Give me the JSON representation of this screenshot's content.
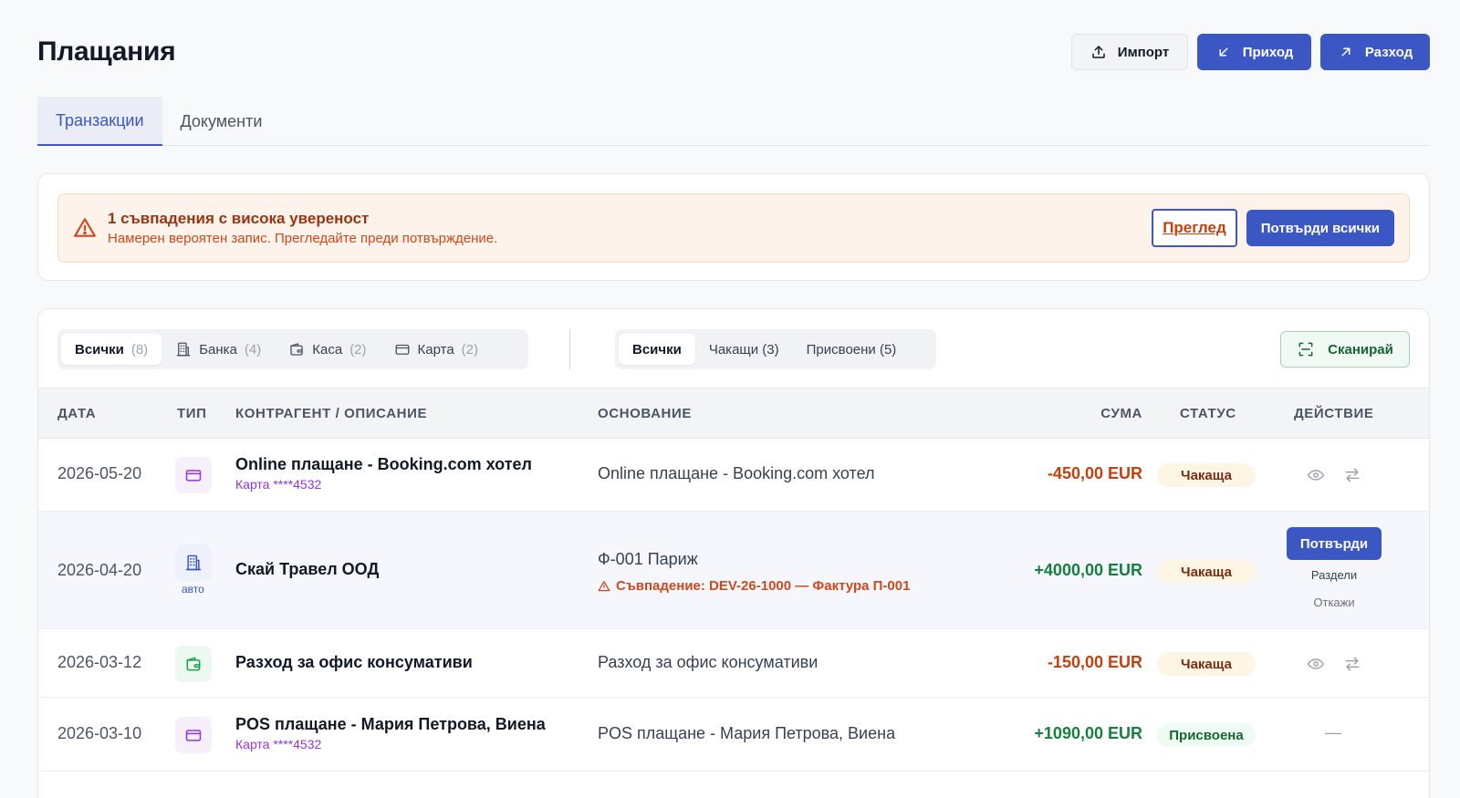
{
  "page": {
    "title": "Плащания"
  },
  "header": {
    "import_label": "Импорт",
    "income_label": "Приход",
    "expense_label": "Разход"
  },
  "tabs": [
    {
      "label": "Транзакции",
      "active": true
    },
    {
      "label": "Документи",
      "active": false
    }
  ],
  "alert": {
    "title": "1 съвпадения с висока увереност",
    "subtitle": "Намерен вероятен запис. Прегледайте преди потвърждение.",
    "review_label": "Преглед",
    "confirm_all_label": "Потвърди всички"
  },
  "filters": {
    "source": [
      {
        "label": "Всички",
        "count": "(8)",
        "active": true
      },
      {
        "label": "Банка",
        "count": "(4)",
        "icon": "bank-icon"
      },
      {
        "label": "Каса",
        "count": "(2)",
        "icon": "wallet-icon"
      },
      {
        "label": "Карта",
        "count": "(2)",
        "icon": "card-icon"
      }
    ],
    "status": [
      {
        "label": "Всички",
        "active": true
      },
      {
        "label": "Чакащи (3)"
      },
      {
        "label": "Присвоени (5)"
      }
    ],
    "scan_label": "Сканирай"
  },
  "table": {
    "headers": {
      "date": "ДАТА",
      "type": "ТИП",
      "party": "КОНТРАГЕНТ / ОПИСАНИЕ",
      "basis": "ОСНОВАНИЕ",
      "amount": "СУМА",
      "status": "СТАТУС",
      "action": "ДЕЙСТВИЕ"
    },
    "rows": [
      {
        "date": "2026-05-20",
        "type": "card",
        "party": "Online плащане - Booking.com хотел",
        "sub": "Карта ****4532",
        "basis": "Online плащане - Booking.com хотел",
        "amount": "-450,00 EUR",
        "status": "Чакаща"
      },
      {
        "date": "2026-04-20",
        "type": "bank",
        "auto": "авто",
        "party": "Скай Травел ООД",
        "basis": "Ф-001 Париж",
        "match": "Съвпадение: DEV-26-1000 — Фактура П-001",
        "amount": "+4000,00 EUR",
        "status": "Чакаща",
        "confirm_label": "Потвърди",
        "split_label": "Раздели",
        "reject_label": "Откажи"
      },
      {
        "date": "2026-03-12",
        "type": "cash",
        "party": "Разход за офис консумативи",
        "basis": "Разход за офис консумативи",
        "amount": "-150,00 EUR",
        "status": "Чакаща"
      },
      {
        "date": "2026-03-10",
        "type": "card",
        "party": "POS плащане - Мария Петрова, Виена",
        "sub": "Карта ****4532",
        "basis": "POS плащане - Мария Петрова, Виена",
        "amount": "+1090,00 EUR",
        "status": "Присвоена",
        "action": "—"
      }
    ]
  },
  "colors": {
    "primary": "#3a57c4",
    "negative": "#c2410c",
    "positive": "#15803d",
    "warning_bg": "#fdf3ea"
  }
}
